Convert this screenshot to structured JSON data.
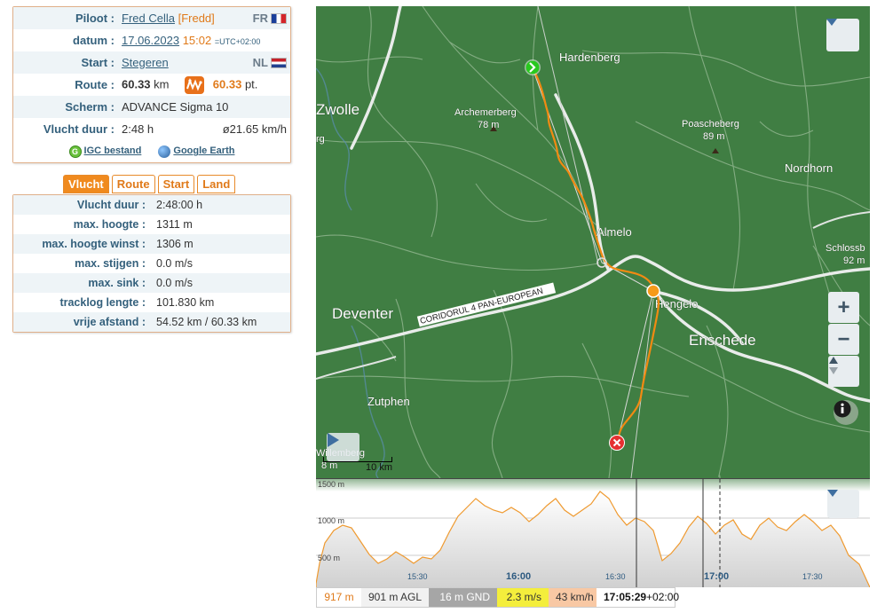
{
  "info": {
    "pilot_label": "Piloot :",
    "pilot_name": "Fred Cella",
    "pilot_nick": "[Fredd]",
    "pilot_country": "FR",
    "date_label": "datum :",
    "date": "17.06.2023",
    "time": "15:02",
    "tz": "=UTC+02:00",
    "start_label": "Start :",
    "start": "Stegeren",
    "start_country": "NL",
    "route_label": "Route :",
    "route_km": "60.33",
    "route_km_unit": "km",
    "route_points": "60.33",
    "route_points_unit": "pt.",
    "glider_label": "Scherm :",
    "glider": "ADVANCE Sigma 10",
    "duration_label": "Vlucht duur :",
    "duration": "2:48 h",
    "avg_speed": "ø21.65 km/h",
    "igc_link": "IGC bestand",
    "ge_link": "Google Earth"
  },
  "tabs": [
    "Vlucht",
    "Route",
    "Start",
    "Land"
  ],
  "stats": [
    {
      "k": "Vlucht duur :",
      "v": "2:48:00 h"
    },
    {
      "k": "max. hoogte :",
      "v": "1311 m"
    },
    {
      "k": "max. hoogte winst :",
      "v": "1306 m"
    },
    {
      "k": "max. stijgen :",
      "v": "0.0 m/s"
    },
    {
      "k": "max. sink :",
      "v": "0.0 m/s"
    },
    {
      "k": "tracklog lengte :",
      "v": "101.830 km"
    },
    {
      "k": "vrije afstand :",
      "v": "54.52 km / 60.33 km"
    }
  ],
  "map": {
    "places": {
      "hardenberg": "Hardenberg",
      "zwolle": "Zwolle",
      "archemerberg": "Archemerberg",
      "archemerberg_alt": "78 m",
      "poascheberg": "Poascheberg",
      "poascheberg_alt": "89 m",
      "nordhorn": "Nordhorn",
      "almelo": "Almelo",
      "schloss": "Schlossb",
      "schloss_alt": "92 m",
      "deventer": "Deventer",
      "hengelo": "Hengelo",
      "enschede": "Enschede",
      "zutphen": "Zutphen",
      "corridor": "CORIDORUL 4 PAN-EUROPEAN",
      "willem": "Willemberg",
      "willem_alt": "8 m",
      "berg_partial": "rg"
    },
    "scale": "10 km",
    "zoom_in": "+",
    "zoom_out": "−"
  },
  "elevation": {
    "y_labels": [
      "1500 m",
      "1000 m",
      "500 m"
    ],
    "x_labels": [
      "15:30",
      "16:00",
      "16:30",
      "17:00",
      "17:30"
    ]
  },
  "status": {
    "alt": "917 m",
    "agl": "901 m AGL",
    "gnd": "16 m GND",
    "vario": "2.3 m/s",
    "speed": "43 km/h",
    "time": "17:05:29",
    "tz": "+02:00"
  }
}
